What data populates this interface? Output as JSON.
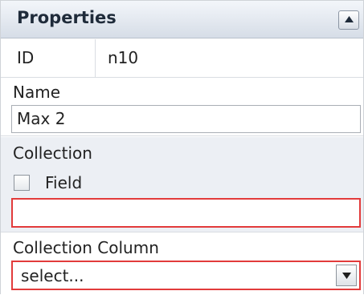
{
  "panel": {
    "title": "Properties",
    "collapse_icon": "triangle-up-icon"
  },
  "id_row": {
    "label": "ID",
    "value": "n10"
  },
  "name_section": {
    "label": "Name",
    "value": "Max 2"
  },
  "collection_section": {
    "label": "Collection",
    "field_checkbox_label": "Field",
    "field_checked": false,
    "input_value": ""
  },
  "collection_column_section": {
    "label": "Collection Column",
    "selected": "select...",
    "dropdown_icon": "triangle-down-icon"
  },
  "colors": {
    "invalid_border": "#e23b3b",
    "header_bg": "#d6dde7",
    "section_alt_bg": "#eceff4"
  }
}
